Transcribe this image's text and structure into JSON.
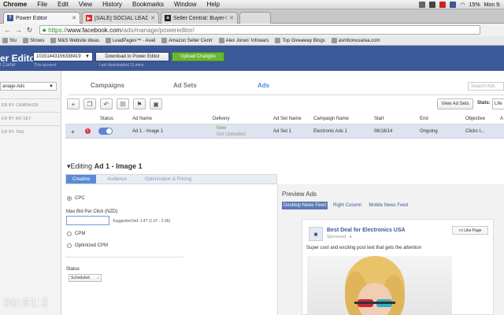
{
  "menubar": {
    "items": [
      "Chrome",
      "File",
      "Edit",
      "View",
      "History",
      "Bookmarks",
      "Window",
      "Help"
    ],
    "battery": "15%",
    "clock": "Mon 9:"
  },
  "tabs": [
    {
      "label": "Power Editor",
      "favicon": "facebook-icon",
      "active": true
    },
    {
      "label": "[SALE] SOCIAL LEAD FREA",
      "favicon": "youtube-icon",
      "active": false
    },
    {
      "label": "Seller Central: Buyer-Selle",
      "favicon": "amazon-icon",
      "active": false
    },
    {
      "label": "",
      "favicon": "blank-icon",
      "active": false
    }
  ],
  "url": {
    "scheme": "https://",
    "host": "www.facebook.com",
    "path": "/ads/manage/powereditor/"
  },
  "bookmarks": [
    "Stu",
    "Strows",
    "M&S Website Ideas",
    "LeadPages™ - Avail",
    "Amazon Seller Centr",
    "Alex Jones' Infowars",
    "Top Giveaway Blogs",
    "asmbonusarea.com"
  ],
  "header": {
    "title": "er Editor",
    "user": "t Carter",
    "account_id": "10151443156338419",
    "account_label": "This account",
    "download_label": "Download to Power Editor",
    "download_status": "Last downloaded 11 mins",
    "upload_label": "Upload Changes"
  },
  "left": {
    "manage": "anage Ads",
    "filters": [
      "ER BY CAMPAIGN",
      "ER BY AD SET",
      "ER BY TAG"
    ]
  },
  "main_tabs": [
    "Campaigns",
    "Ad Sets",
    "Ads"
  ],
  "search_placeholder": "Search Ads",
  "toolbar": {
    "view_adsets": "View Ad Sets",
    "stats_label": "Stats:",
    "stats_value": "Life"
  },
  "table": {
    "headers": [
      "Status",
      "Ad Name",
      "Delivery",
      "Ad Set Name",
      "Campaign Name",
      "Start",
      "End",
      "Objective",
      "A"
    ],
    "row": {
      "ad_name": "Ad 1 - Image 1",
      "delivery_1": "New",
      "delivery_2": "Not Uploaded",
      "ad_set": "Ad Set 1",
      "campaign": "Electronic Ads 1",
      "start": "06/18/14",
      "end": "Ongoing",
      "objective": "Clicks t..."
    }
  },
  "editing": {
    "prefix": "Editing",
    "name": "Ad 1 - Image 1"
  },
  "edit_tabs": [
    "Creative",
    "Audience",
    "Optimization & Pricing"
  ],
  "pricing": {
    "cpc": "CPC",
    "max_bid_label": "Max Bid Per Click (NZD)",
    "max_bid_value": "",
    "suggested": "Suggested bid: 1.47 (1.07 - 2.06)",
    "cpm": "CPM",
    "ocpm": "Optimized CPM",
    "status_label": "Status",
    "status_value": "Scheduled"
  },
  "preview": {
    "title": "Preview Ads",
    "tabs": [
      "Desktop News Feed",
      "Right Column",
      "Mobile News Feed"
    ],
    "page_name": "Best Deal for Electronics USA",
    "sponsored": "Sponsored · ",
    "like": "Like Page",
    "post_text": "Super cool and exciting post text that gets the attention"
  },
  "timer": "00:51:2",
  "colors": {
    "facebook_blue": "#3b5998",
    "upload_green": "#6ab636",
    "active_tab_blue": "#4a8adf"
  }
}
